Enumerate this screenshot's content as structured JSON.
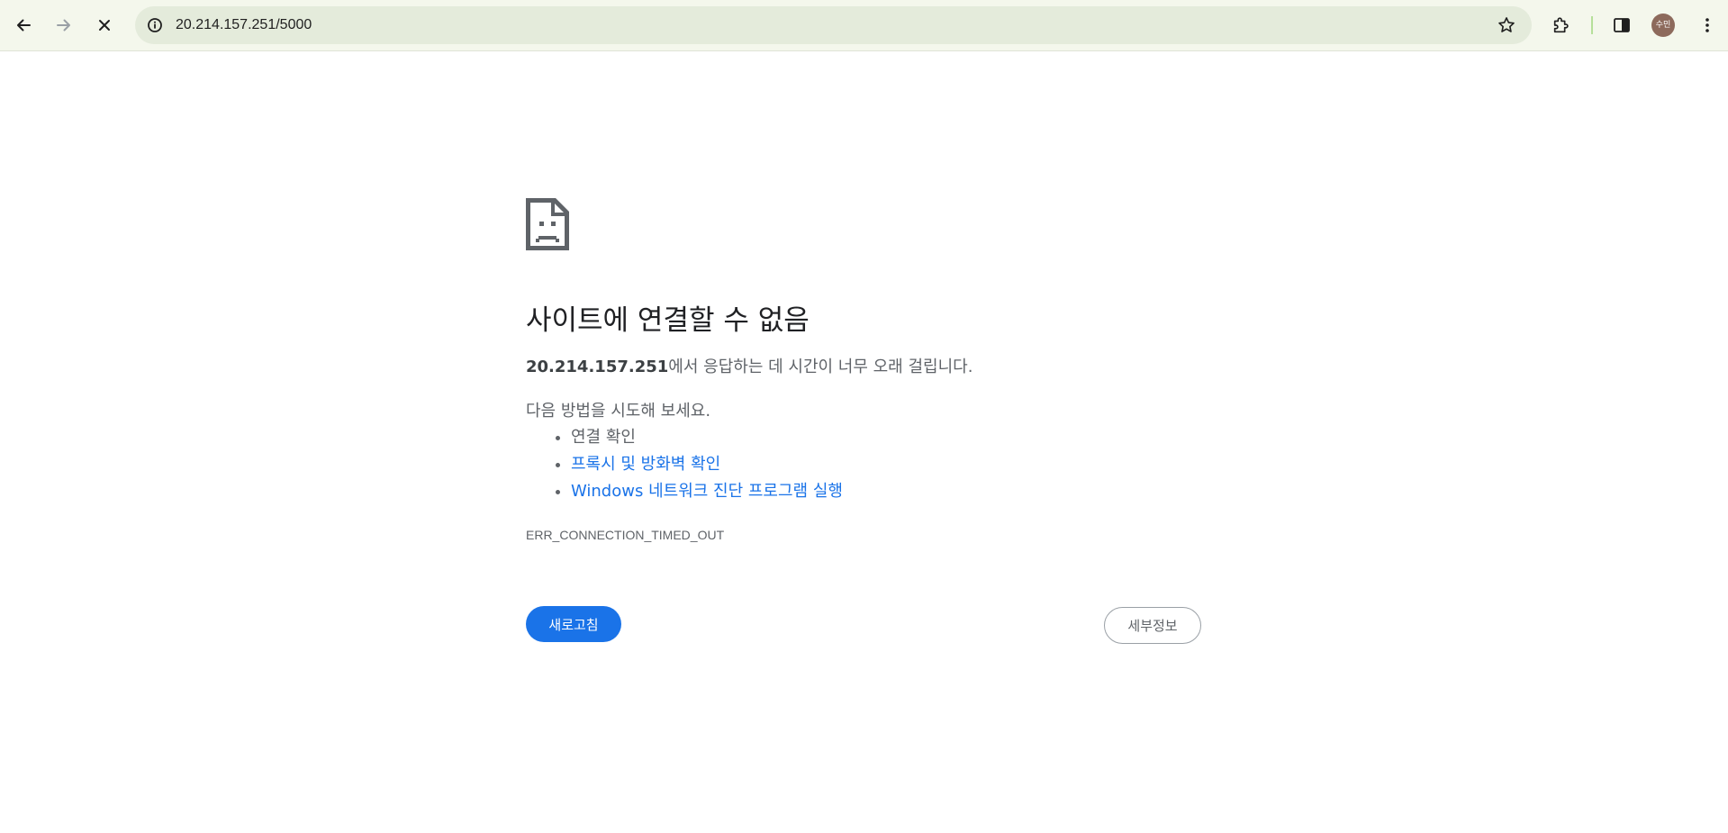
{
  "browser": {
    "url": "20.214.157.251/5000",
    "profile_initials": "수민",
    "icons": {
      "back": "arrow-left-icon",
      "forward": "arrow-right-icon",
      "stop": "close-icon",
      "site_info": "info-icon",
      "bookmark": "star-icon",
      "extensions": "puzzle-icon",
      "side_panel": "side-panel-icon",
      "menu": "more-vertical-icon"
    },
    "colors": {
      "toolbar_bg": "#f4f7ec",
      "omnibox_bg": "#e4ebdb",
      "avatar_bg": "#8d6a5c"
    }
  },
  "error_page": {
    "icon": "sad-document-icon",
    "title": "사이트에 연결할 수 없음",
    "summary_host": "20.214.157.251",
    "summary_text": "에서 응답하는 데 시간이 너무 오래 걸립니다.",
    "suggestions_heading": "다음 방법을 시도해 보세요.",
    "suggestions": [
      {
        "label": "연결 확인",
        "is_link": false
      },
      {
        "label": "프록시 및 방화벽 확인",
        "is_link": true
      },
      {
        "label": "Windows 네트워크 진단 프로그램 실행",
        "is_link": true
      }
    ],
    "error_code": "ERR_CONNECTION_TIMED_OUT",
    "reload_label": "새로고침",
    "details_label": "세부정보",
    "colors": {
      "link": "#1a73e8",
      "primary_button": "#1a73e8",
      "text": "#5f6368",
      "title": "#202124"
    }
  }
}
